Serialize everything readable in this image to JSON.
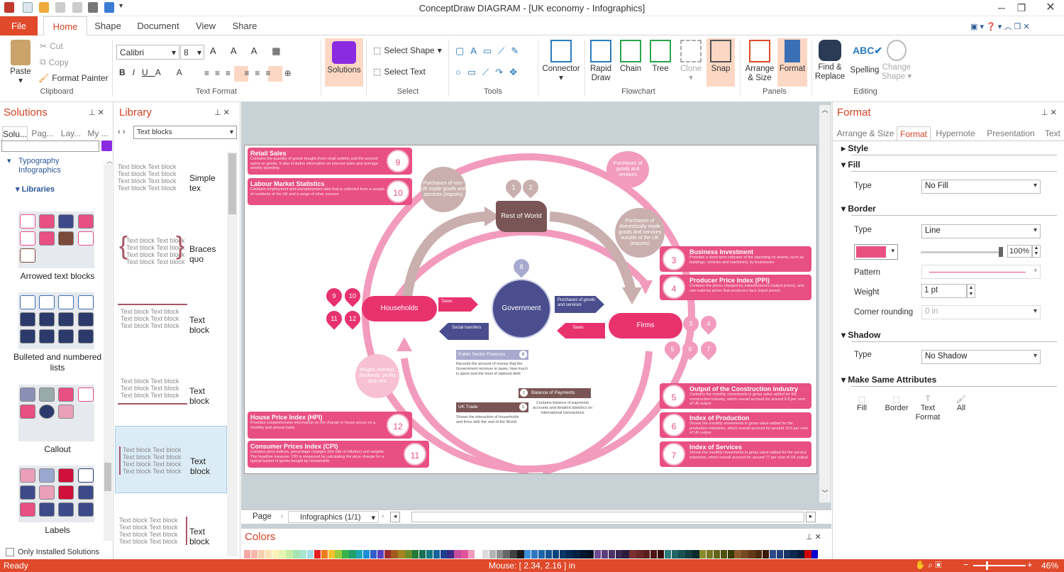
{
  "window": {
    "title": "ConceptDraw DIAGRAM - [UK economy - Infographics]"
  },
  "ribbon_tabs": [
    "File",
    "Home",
    "Shape",
    "Document",
    "View",
    "Share"
  ],
  "clipboard": {
    "paste": "Paste",
    "cut": "Cut",
    "copy": "Copy",
    "format_painter": "Format Painter",
    "label": "Clipboard"
  },
  "text_format": {
    "font": "Calibri",
    "size": "8",
    "label": "Text Format"
  },
  "solutions_btn": "Solutions",
  "select": {
    "select_shape": "Select Shape",
    "select_text": "Select Text",
    "label": "Select"
  },
  "tools_label": "Tools",
  "connector": "Connector",
  "flowchart": {
    "rapid_draw": "Rapid Draw",
    "chain": "Chain",
    "tree": "Tree",
    "clone": "Clone",
    "snap": "Snap",
    "label": "Flowchart"
  },
  "panels": {
    "arrange": "Arrange & Size",
    "format": "Format",
    "label": "Panels"
  },
  "editing": {
    "find": "Find & Replace",
    "spelling": "Spelling",
    "change_shape": "Change Shape",
    "label": "Editing"
  },
  "solutions_panel": {
    "title": "Solutions",
    "tabs": [
      "Solu...",
      "Pag...",
      "Lay...",
      "My ..."
    ],
    "tree_item": "Typography Infographics",
    "libraries": "Libraries",
    "captions": [
      "Arrowed text blocks",
      "Bulleted and numbered lists",
      "Callout",
      "Labels"
    ],
    "only_installed": "Only Installed Solutions"
  },
  "library_panel": {
    "title": "Library",
    "dropdown": "Text blocks",
    "items": [
      {
        "name": "Simple tex",
        "sample": "Text block Text block"
      },
      {
        "name": "Braces quo",
        "sample": "Text block Text block"
      },
      {
        "name": "Text block",
        "sample": "Text block Text block"
      },
      {
        "name": "Text block",
        "sample": "Text block Text block"
      },
      {
        "name": "Text block",
        "sample": "Text block Text block"
      },
      {
        "name": "Text block",
        "sample": "Text block Text block"
      }
    ]
  },
  "diagram": {
    "cards_left": [
      {
        "title": "Retail Sales",
        "desc": "Contains the quantity of goods bought (from retail outlets) and the amount spent on goods. It also includes information on internet sales and average weekly spending",
        "num": "9"
      },
      {
        "title": "Labour Market Statistics",
        "desc": "Contains employment and unemployment data that is collected from a sample of residents of the UK and a range of other sources",
        "num": "10"
      },
      {
        "title": "House Price Index (HPI)",
        "desc": "Provides comprehensive information on the change in house prices on a monthly and annual basis",
        "num": "12"
      },
      {
        "title": "Consumer Prices Index (CPI)",
        "desc": "Contains price indices, percentage changes (the rate of inflation) and weights. The headline measure. CPI is measured by calculating the price change for a typical basket of goods bought by households",
        "num": "11"
      }
    ],
    "cards_right": [
      {
        "title": "Business Investment",
        "desc": "Provides a short-term indicator of the spending on assets, such as buildings, vehicles and machinery, by businesses",
        "num": "3"
      },
      {
        "title": "Producer Price Index (PPI)",
        "desc": "Contains the prices charged by manufacturers (output prices), and raw material prices that producers face (input prices)",
        "num": "4"
      },
      {
        "title": "Output of the Construction industry",
        "desc": "Contains the monthly movements in gross value added for the construction industry, which overall account for around 6.8 per cent of UK output",
        "num": "5"
      },
      {
        "title": "Index of Production",
        "desc": "Shows the monthly movements in gross value added for the production industries, which overall account for around 15.6 per cent of UK output",
        "num": "6"
      },
      {
        "title": "Index of Services",
        "desc": "Shows the monthly movements in gross value added for the service industries, which overall account for around 77 per cent of UK output",
        "num": "7"
      }
    ],
    "households": "Households",
    "firms": "Firms",
    "government": "Government",
    "rest_of_world": "Rest of World",
    "taxes": "Taxes",
    "social_transfers": "Social transfers",
    "purchases_gs": "Purchases of goods and services",
    "taxes2": "Taxes",
    "imports": "Purchases of non-UK made goods and services (imports)",
    "exports": "Purchases of domestically made goods and services outside of the UK (exports)",
    "purchases_top": "Purchases of goods and services",
    "wages": "Wages, interest, dividends, profits and rent",
    "psf": {
      "title": "Public Sector Finances",
      "num": "8",
      "desc": "Records the amount of money that the Government receives in taxes, how much is spent and the level of national debt"
    },
    "bop": {
      "title": "Balance of Payments",
      "num": "1",
      "desc": "Contains balance of payments accounts and detailed statistics on international transactions"
    },
    "trade": {
      "title": "UK Trade",
      "num": "2",
      "desc": "Shows the interaction of households and firms with the rest of the World"
    },
    "pins_top": [
      "1",
      "2"
    ],
    "pin_gov": "8",
    "pins_hh": [
      "9",
      "10",
      "11",
      "12"
    ],
    "pins_firms": [
      "3",
      "4",
      "5",
      "6",
      "7"
    ]
  },
  "page_nav": {
    "label": "Page",
    "page": "Infographics (1/1)"
  },
  "colors_panel": {
    "title": "Colors",
    "swatches": [
      "#f7a6a6",
      "#f9b9a9",
      "#fbd0b0",
      "#fde2b3",
      "#fdf2b8",
      "#e6f5b1",
      "#c7eca7",
      "#a8e3b3",
      "#a6e6d3",
      "#a6dfe8",
      "#e02020",
      "#f07c1e",
      "#f6c02c",
      "#9ccc3b",
      "#37b34a",
      "#1f9f6a",
      "#1ba7b5",
      "#1a8fd6",
      "#2f5fc7",
      "#5a3fc0",
      "#9b2c2c",
      "#a35a1e",
      "#a3841f",
      "#6c8c2a",
      "#217a36",
      "#167052",
      "#137780",
      "#14649a",
      "#1e3f8e",
      "#3c2a87",
      "#c44d9e",
      "#e2549a",
      "#f29bbd",
      "#ffffff",
      "#dcdcdc",
      "#b3b3b3",
      "#8c8c8c",
      "#666666",
      "#404040",
      "#1a1a1a",
      "#3d8fd9",
      "#2f78c0",
      "#2066a8",
      "#145591",
      "#0b447a",
      "#063566",
      "#032852",
      "#021e40",
      "#01152f",
      "#000e20",
      "#6b4a8f",
      "#5a3e7a",
      "#4a3266",
      "#3a2752",
      "#2b1c3e",
      "#7a3030",
      "#6a2626",
      "#5a1d1d",
      "#4a1414",
      "#3a0b0b",
      "#2c7a7a",
      "#236666",
      "#1a5252",
      "#123e3e",
      "#0a2a2a",
      "#8a8a2c",
      "#767622",
      "#626218",
      "#4e4e0e",
      "#3a3a05",
      "#8a5a2c",
      "#764a22",
      "#623a18",
      "#4e2a0e",
      "#3a1a05",
      "#2c4a8a",
      "#223e76",
      "#183262",
      "#0e264e",
      "#051a3a",
      "#cc0000",
      "#0000cc"
    ]
  },
  "format_panel": {
    "title": "Format",
    "tabs": [
      "Arrange & Size",
      "Format",
      "Hypernote",
      "Presentation",
      "Text"
    ],
    "style": "Style",
    "fill": "Fill",
    "fill_type_label": "Type",
    "fill_type": "No Fill",
    "border": "Border",
    "border_type_label": "Type",
    "border_type": "Line",
    "border_color": "#ea4f82",
    "opacity": "100%",
    "pattern": "Pattern",
    "weight_label": "Weight",
    "weight": "1 pt",
    "corner_label": "Corner rounding",
    "corner": "0 in",
    "shadow": "Shadow",
    "shadow_type_label": "Type",
    "shadow_type": "No Shadow",
    "same_attr": "Make Same Attributes",
    "same": [
      "Fill",
      "Border",
      "Text Format",
      "All"
    ]
  },
  "status": {
    "ready": "Ready",
    "mouse": "Mouse: [ 2.34, 2.16 ] in",
    "zoom": "46%"
  }
}
